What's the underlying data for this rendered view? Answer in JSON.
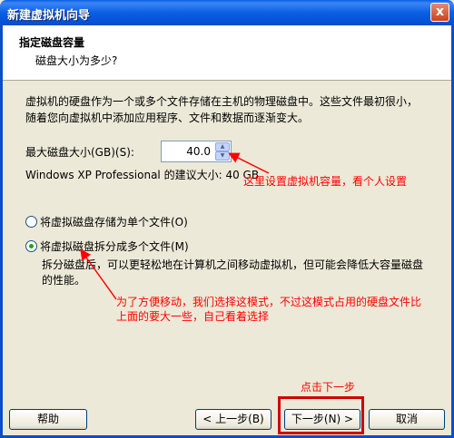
{
  "window": {
    "title": "新建虚拟机向导",
    "close_glyph": "x"
  },
  "header": {
    "title": "指定磁盘容量",
    "subtitle": "磁盘大小为多少?"
  },
  "description": "虚拟机的硬盘作为一个或多个文件存储在主机的物理磁盘中。这些文件最初很小，随着您向虚拟机中添加应用程序、文件和数据而逐渐变大。",
  "disk_size": {
    "label": "最大磁盘大小(GB)(S):",
    "value": "40.0"
  },
  "recommendation": "Windows XP Professional 的建议大小: 40 GB",
  "options": [
    {
      "label": "将虚拟磁盘存储为单个文件(O)",
      "checked": false
    },
    {
      "label": "将虚拟磁盘拆分成多个文件(M)",
      "checked": true
    }
  ],
  "split_description": "拆分磁盘后，可以更轻松地在计算机之间移动虚拟机，但可能会降低大容量磁盘的性能。",
  "annotations": {
    "disk_note": "这里设置虚拟机容量，看个人设置",
    "split_note": "为了方便移动，我们选择这模式，不过这模式占用的硬盘文件比上面的要大一些，自己看着选择",
    "next_note": "点击下一步"
  },
  "buttons": {
    "help": "帮助",
    "back": "< 上一步(B)",
    "next": "下一步(N) >",
    "cancel": "取消"
  },
  "colors": {
    "annotation": "#ff0000",
    "titlebar": "#0a5fe3",
    "dialog_bg": "#ece9d8"
  }
}
